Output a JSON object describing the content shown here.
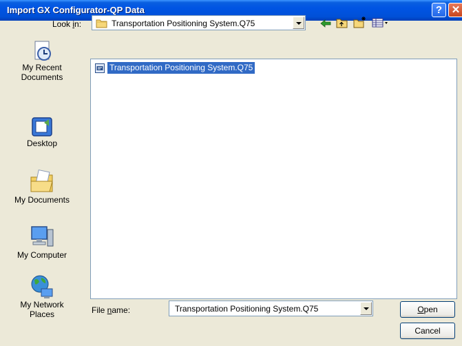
{
  "window": {
    "title": "Import GX Configurator-QP Data",
    "help_label": "?",
    "close_label": "✕"
  },
  "toolbar": {
    "look_in_label_pre": "Look ",
    "look_in_label_acc": "i",
    "look_in_label_post": "n:",
    "look_in_value": "Transportation Positioning System.Q75",
    "buttons": [
      "back-icon",
      "up-folder-icon",
      "new-folder-icon",
      "views-menu-icon"
    ]
  },
  "places": [
    {
      "line1": "My Recent",
      "line2": "Documents",
      "icon": "recent-documents-icon"
    },
    {
      "line1": "Desktop",
      "line2": "",
      "icon": "desktop-icon"
    },
    {
      "line1": "My Documents",
      "line2": "",
      "icon": "my-documents-icon"
    },
    {
      "line1": "My Computer",
      "line2": "",
      "icon": "my-computer-icon"
    },
    {
      "line1": "My Network",
      "line2": "Places",
      "icon": "network-places-icon"
    }
  ],
  "files": [
    {
      "name": "Transportation Positioning System.Q75",
      "selected": true
    }
  ],
  "filename": {
    "label_pre": "File ",
    "label_acc": "n",
    "label_post": "ame:",
    "value": "Transportation Positioning System.Q75"
  },
  "buttons": {
    "open_acc": "O",
    "open_rest": "pen",
    "cancel": "Cancel"
  },
  "colors": {
    "title_bar": "#0054e3",
    "selection": "#316ac5",
    "dialog_bg": "#ece9d8"
  }
}
